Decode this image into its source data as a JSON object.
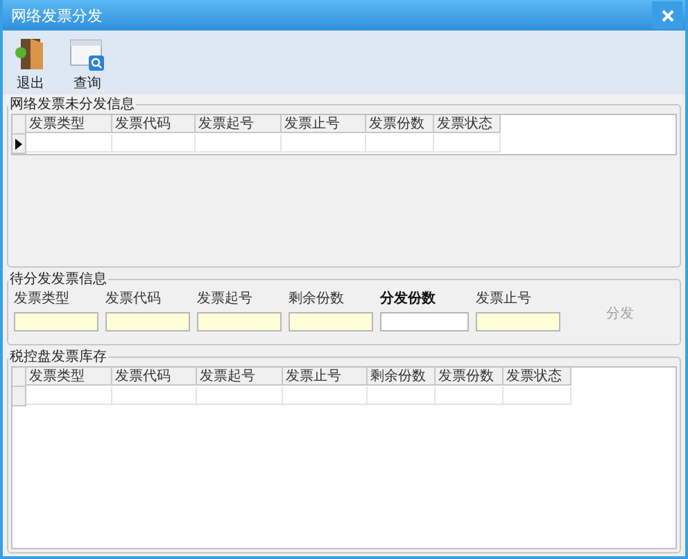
{
  "window": {
    "title": "网络发票分发"
  },
  "toolbar": [
    {
      "label": "退出",
      "kind": "exit"
    },
    {
      "label": "查询",
      "kind": "query"
    }
  ],
  "undistributed": {
    "title": "网络发票未分发信息",
    "columns": [
      "发票类型",
      "发票代码",
      "发票起号",
      "发票止号",
      "发票份数",
      "发票状态"
    ],
    "rows": [
      {
        "current": true
      }
    ]
  },
  "pending": {
    "title": "待分发发票信息",
    "fields": [
      {
        "label": "发票类型",
        "editable": false,
        "emphasis": false
      },
      {
        "label": "发票代码",
        "editable": false,
        "emphasis": false
      },
      {
        "label": "发票起号",
        "editable": false,
        "emphasis": false
      },
      {
        "label": "剩余份数",
        "editable": false,
        "emphasis": false
      },
      {
        "label": "分发份数",
        "editable": true,
        "emphasis": true
      },
      {
        "label": "发票止号",
        "editable": false,
        "emphasis": false
      }
    ],
    "button": {
      "label": "分发",
      "disabled": true
    }
  },
  "inventory": {
    "title": "税控盘发票库存",
    "columns": [
      "发票类型",
      "发票代码",
      "发票起号",
      "发票止号",
      "剩余份数",
      "发票份数",
      "发票状态"
    ],
    "rows": [
      {
        "current": false
      }
    ]
  }
}
